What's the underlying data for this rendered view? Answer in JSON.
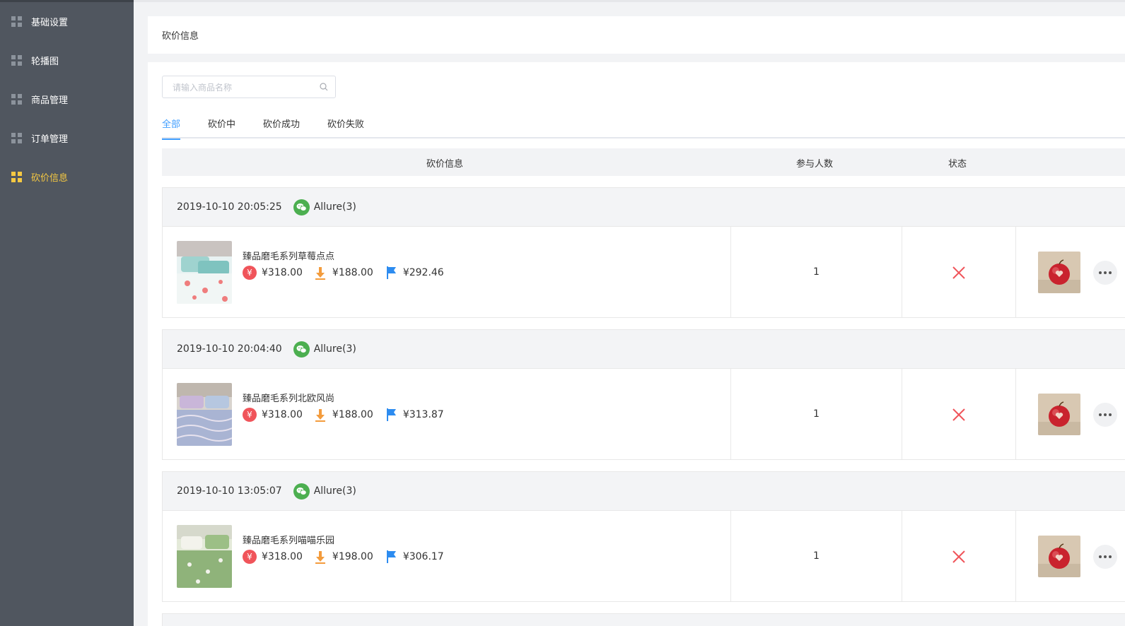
{
  "sidebar": {
    "items": [
      {
        "label": "基础设置",
        "icon": "grid-icon",
        "active": false
      },
      {
        "label": "轮播图",
        "icon": "grid-icon",
        "active": false
      },
      {
        "label": "商品管理",
        "icon": "grid-icon",
        "active": false
      },
      {
        "label": "订单管理",
        "icon": "grid-icon",
        "active": false
      },
      {
        "label": "砍价信息",
        "icon": "grid-icon",
        "active": true
      }
    ]
  },
  "page": {
    "title": "砍价信息"
  },
  "search": {
    "placeholder": "请输入商品名称",
    "icon": "search-icon"
  },
  "tabs": [
    {
      "label": "全部",
      "active": true
    },
    {
      "label": "砍价中",
      "active": false
    },
    {
      "label": "砍价成功",
      "active": false
    },
    {
      "label": "砍价失败",
      "active": false
    }
  ],
  "table": {
    "headers": {
      "info": "砍价信息",
      "participants": "参与人数",
      "status": "状态"
    }
  },
  "orders": [
    {
      "time": "2019-10-10 20:05:25",
      "user": "Allure(3)",
      "product": "臻品磨毛系列草莓点点",
      "original_price": "¥318.00",
      "floor_price": "¥188.00",
      "current_price": "¥292.46",
      "participants": "1",
      "status_icon": "close-icon"
    },
    {
      "time": "2019-10-10 20:04:40",
      "user": "Allure(3)",
      "product": "臻品磨毛系列北欧风尚",
      "original_price": "¥318.00",
      "floor_price": "¥188.00",
      "current_price": "¥313.87",
      "participants": "1",
      "status_icon": "close-icon"
    },
    {
      "time": "2019-10-10 13:05:07",
      "user": "Allure(3)",
      "product": "臻品磨毛系列喵喵乐园",
      "original_price": "¥318.00",
      "floor_price": "¥198.00",
      "current_price": "¥306.17",
      "participants": "1",
      "status_icon": "close-icon"
    }
  ],
  "icons": {
    "wechat": "wechat-icon",
    "yen": "yen-icon",
    "arrow": "arrow-down-icon",
    "flag": "flag-icon",
    "more": "more-icon"
  },
  "colors": {
    "sidebar": "#50565f",
    "active_nav": "#f5c842",
    "active_tab": "#409eff",
    "status_fail": "#f0545a",
    "wechat": "#4caf50",
    "arrow": "#f39c3d",
    "flag": "#2d8cf0"
  },
  "yen_symbol": "¥"
}
